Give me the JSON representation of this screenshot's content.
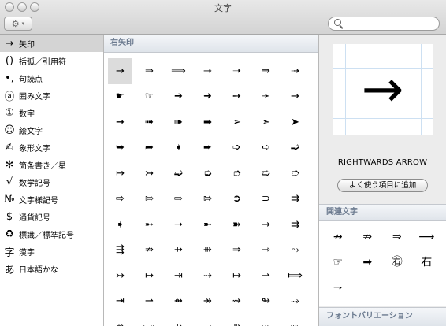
{
  "window": {
    "title": "文字"
  },
  "toolbar": {
    "gear_icon": "gear-icon",
    "gear_symbol": "⚙",
    "chevron": "▾",
    "search_placeholder": "",
    "search_value": ""
  },
  "sidebar": {
    "selected_index": 0,
    "items": [
      {
        "icon": "→",
        "label": "矢印"
      },
      {
        "icon": "()",
        "label": "括弧／引用符"
      },
      {
        "icon": "•,",
        "label": "句読点"
      },
      {
        "icon": "ⓐ",
        "label": "囲み文字"
      },
      {
        "icon": "①",
        "label": "数字"
      },
      {
        "icon": "☺",
        "label": "絵文字"
      },
      {
        "icon": "✍",
        "label": "象形文字"
      },
      {
        "icon": "✻",
        "label": "箇条書き／星"
      },
      {
        "icon": "√",
        "label": "数学記号"
      },
      {
        "icon": "№",
        "label": "文字様記号"
      },
      {
        "icon": "$",
        "label": "通貨記号"
      },
      {
        "icon": "♻",
        "label": "標識／標準記号"
      },
      {
        "icon": "字",
        "label": "漢字"
      },
      {
        "icon": "あ",
        "label": "日本語かな"
      }
    ]
  },
  "main": {
    "section_title": "右矢印",
    "selected_index": 0,
    "characters": [
      "→",
      "⇒",
      "⟹",
      "⇾",
      "➝",
      "⇛",
      "⇢",
      "☛",
      "☞",
      "➔",
      "➜",
      "➙",
      "➛",
      "→",
      "➞",
      "➟",
      "➠",
      "➡",
      "➢",
      "➣",
      "➤",
      "➥",
      "➦",
      "➧",
      "➨",
      "➩",
      "➪",
      "➫",
      "↦",
      "↣",
      "➫",
      "➭",
      "➮",
      "➯",
      "➱",
      "⇨",
      "⇰",
      "⇨",
      "⇰",
      "➲",
      "⊃",
      "⇉",
      "➧",
      "➸",
      "➝",
      "➼",
      "➽",
      "→",
      "⇉",
      "⇶",
      "⇏",
      "⇸",
      "⇻",
      "⇒",
      "⇾",
      "⤳",
      "↣",
      "↦",
      "⇥",
      "⇢",
      "↦",
      "⇀",
      "⟾",
      "⇥",
      "⇀",
      "⇴",
      "↠",
      "⇝",
      "↬",
      "⤑",
      "⇴",
      "⤐",
      "⇸",
      "⤏",
      "⇻",
      "⤔",
      "⤗"
    ]
  },
  "detail": {
    "character": "→",
    "name": "RIGHTWARDS ARROW",
    "favorite_button": "よく使う項目に追加",
    "related_title": "関連文字",
    "related": [
      "↛",
      "⇏",
      "⇒",
      "⟶",
      "☞",
      "➡",
      "㊨",
      "右",
      "⇁"
    ],
    "font_variation_title": "フォントバリエーション"
  }
}
